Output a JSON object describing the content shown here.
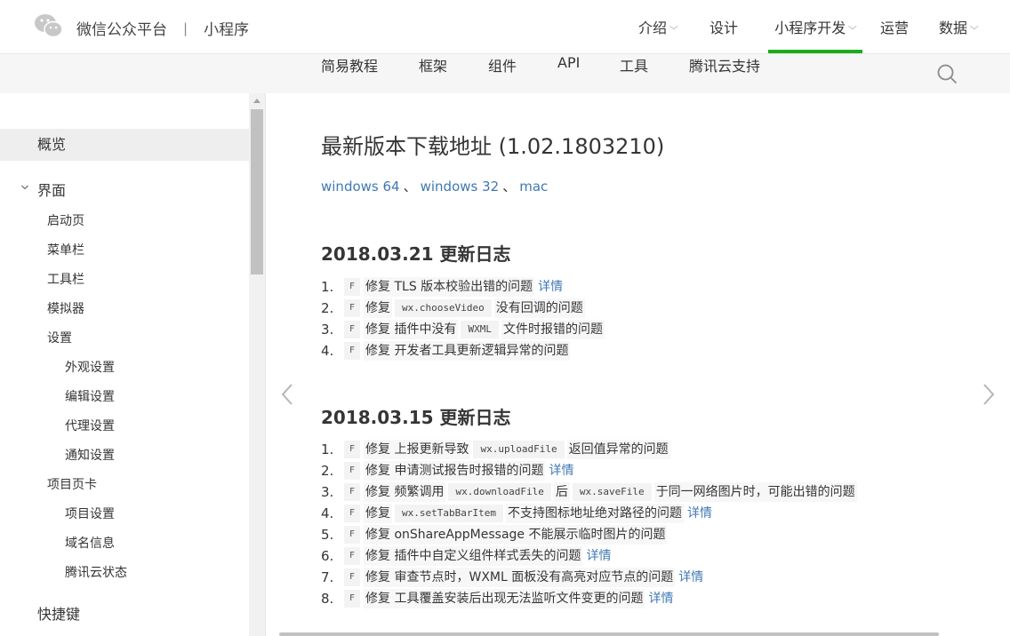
{
  "header": {
    "brand": "微信公众平台",
    "separator": "|",
    "product": "小程序",
    "nav": [
      {
        "label": "介绍",
        "dropdown": true
      },
      {
        "label": "设计",
        "dropdown": false
      },
      {
        "label": "小程序开发",
        "dropdown": true,
        "active": true
      },
      {
        "label": "运营",
        "dropdown": false
      },
      {
        "label": "数据",
        "dropdown": true
      }
    ]
  },
  "subnav": {
    "items": [
      {
        "label": "简易教程"
      },
      {
        "label": "框架"
      },
      {
        "label": "组件"
      },
      {
        "label": "API"
      },
      {
        "label": "工具",
        "active": true
      },
      {
        "label": "腾讯云支持"
      }
    ],
    "search_icon": "search-icon"
  },
  "sidebar": {
    "items": [
      {
        "label": "概览",
        "level": 1,
        "selected": true
      },
      {
        "label": "界面",
        "level": 1,
        "expanded": true
      },
      {
        "label": "启动页",
        "level": 2
      },
      {
        "label": "菜单栏",
        "level": 2
      },
      {
        "label": "工具栏",
        "level": 2
      },
      {
        "label": "模拟器",
        "level": 2
      },
      {
        "label": "设置",
        "level": 2
      },
      {
        "label": "外观设置",
        "level": 3
      },
      {
        "label": "编辑设置",
        "level": 3
      },
      {
        "label": "代理设置",
        "level": 3
      },
      {
        "label": "通知设置",
        "level": 3
      },
      {
        "label": "项目页卡",
        "level": 2
      },
      {
        "label": "项目设置",
        "level": 3
      },
      {
        "label": "域名信息",
        "level": 3
      },
      {
        "label": "腾讯云状态",
        "level": 3
      },
      {
        "label": "快捷键",
        "level": 1
      }
    ]
  },
  "main": {
    "title": "最新版本下载地址 (1.02.1803210)",
    "downloads": [
      "windows 64",
      "windows 32",
      "mac"
    ],
    "download_sep": "、",
    "sections": [
      {
        "heading": "2018.03.21 更新日志",
        "entries": [
          {
            "num": "1.",
            "tag": "F",
            "parts": [
              {
                "t": "txt",
                "v": "修复 TLS 版本校验出错的问题"
              },
              {
                "t": "link",
                "v": "详情"
              }
            ]
          },
          {
            "num": "2.",
            "tag": "F",
            "parts": [
              {
                "t": "txt",
                "v": "修复"
              },
              {
                "t": "code",
                "v": "wx.chooseVideo"
              },
              {
                "t": "txt",
                "v": "没有回调的问题"
              }
            ]
          },
          {
            "num": "3.",
            "tag": "F",
            "parts": [
              {
                "t": "txt",
                "v": "修复 插件中没有"
              },
              {
                "t": "code",
                "v": "WXML"
              },
              {
                "t": "txt",
                "v": "文件时报错的问题"
              }
            ]
          },
          {
            "num": "4.",
            "tag": "F",
            "parts": [
              {
                "t": "txt",
                "v": "修复 开发者工具更新逻辑异常的问题"
              }
            ]
          }
        ]
      },
      {
        "heading": "2018.03.15 更新日志",
        "entries": [
          {
            "num": "1.",
            "tag": "F",
            "parts": [
              {
                "t": "txt",
                "v": "修复 上报更新导致"
              },
              {
                "t": "code",
                "v": "wx.uploadFile"
              },
              {
                "t": "txt",
                "v": "返回值异常的问题"
              }
            ]
          },
          {
            "num": "2.",
            "tag": "F",
            "parts": [
              {
                "t": "txt",
                "v": "修复 申请测试报告时报错的问题"
              },
              {
                "t": "link",
                "v": "详情"
              }
            ]
          },
          {
            "num": "3.",
            "tag": "F",
            "parts": [
              {
                "t": "txt",
                "v": "修复 频繁调用"
              },
              {
                "t": "code",
                "v": "wx.downloadFile"
              },
              {
                "t": "txt",
                "v": "后"
              },
              {
                "t": "code",
                "v": "wx.saveFile"
              },
              {
                "t": "txt",
                "v": "于同一网络图片时，可能出错的问题"
              }
            ]
          },
          {
            "num": "4.",
            "tag": "F",
            "parts": [
              {
                "t": "txt",
                "v": "修复"
              },
              {
                "t": "code",
                "v": "wx.setTabBarItem"
              },
              {
                "t": "txt",
                "v": "不支持图标地址绝对路径的问题"
              },
              {
                "t": "link",
                "v": "详情"
              }
            ]
          },
          {
            "num": "5.",
            "tag": "F",
            "parts": [
              {
                "t": "txt",
                "v": "修复 onShareAppMessage 不能展示临时图片的问题"
              }
            ]
          },
          {
            "num": "6.",
            "tag": "F",
            "parts": [
              {
                "t": "txt",
                "v": "修复 插件中自定义组件样式丢失的问题"
              },
              {
                "t": "link",
                "v": "详情"
              }
            ]
          },
          {
            "num": "7.",
            "tag": "F",
            "parts": [
              {
                "t": "txt",
                "v": "修复 审查节点时，WXML 面板没有高亮对应节点的问题"
              },
              {
                "t": "link",
                "v": "详情"
              }
            ]
          },
          {
            "num": "8.",
            "tag": "F",
            "parts": [
              {
                "t": "txt",
                "v": "修复 工具覆盖安装后出现无法监听文件变更的问题"
              },
              {
                "t": "link",
                "v": "详情"
              }
            ]
          }
        ]
      }
    ]
  },
  "colors": {
    "accent_green": "#1aad19",
    "link_blue": "#3f78b5"
  }
}
